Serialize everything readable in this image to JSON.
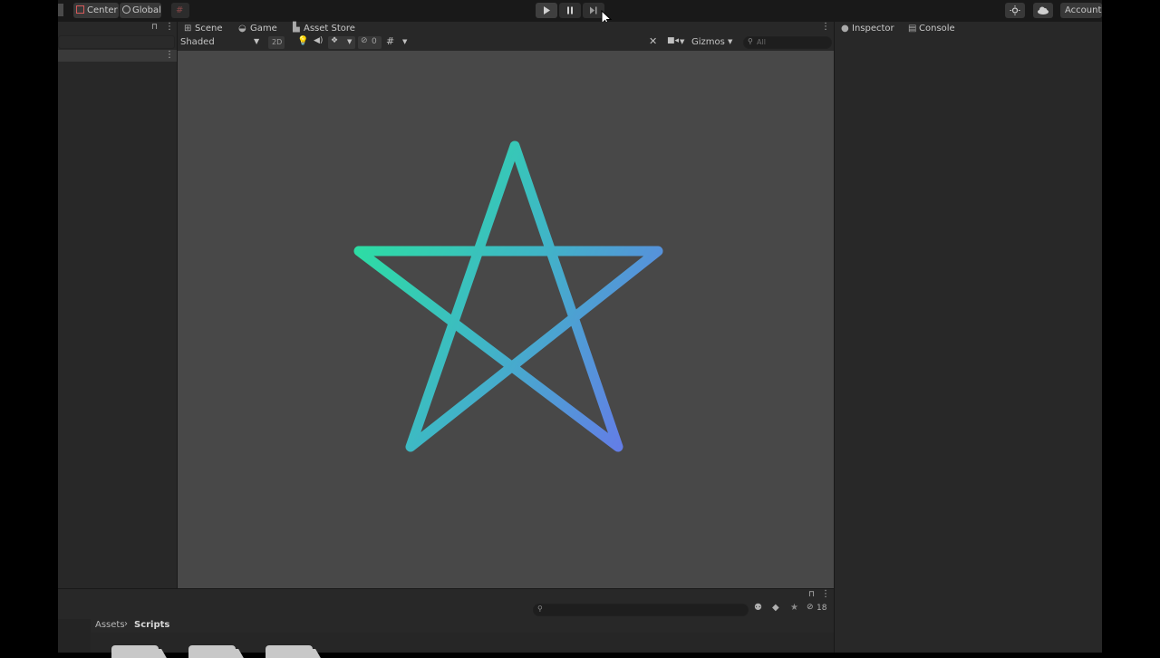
{
  "toolbar": {
    "pivot_label": "Center",
    "space_label": "Global",
    "account_label": "Account"
  },
  "scene_view": {
    "tabs": [
      {
        "label": "Scene",
        "icon": "grid-icon"
      },
      {
        "label": "Game",
        "icon": "gamepad-icon"
      },
      {
        "label": "Asset Store",
        "icon": "bag-icon"
      }
    ],
    "shading_mode": "Shaded",
    "mode_2d_label": "2D",
    "hidden_count": "0",
    "gizmos_label": "Gizmos",
    "search_placeholder": "All",
    "star": {
      "gradient_start": "#28e89a",
      "gradient_end": "#6a73ec",
      "stroke_color_mid": "#3fb6c6"
    }
  },
  "inspector": {
    "tabs": [
      {
        "label": "Inspector",
        "icon": "info-icon"
      },
      {
        "label": "Console",
        "icon": "console-icon"
      }
    ]
  },
  "project": {
    "breadcrumb": [
      "Assets",
      "Scripts"
    ],
    "visible_count": "18"
  },
  "colors": {
    "background": "#191919",
    "panel": "#282828",
    "viewport": "#484848"
  }
}
